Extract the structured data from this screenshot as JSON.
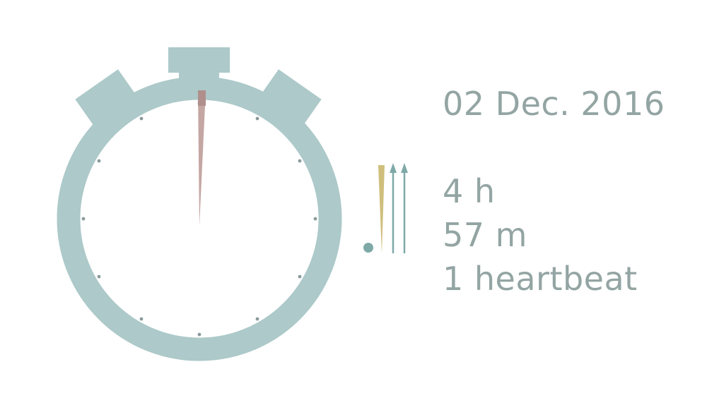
{
  "date": "02 Dec. 2016",
  "duration": {
    "hours": "4 h",
    "minutes": "57 m",
    "heartbeats": "1 heartbeat"
  },
  "colors": {
    "watch_body": "#adc9c9",
    "watch_body_dark": "#8fb6b6",
    "tick": "#8a9a9c",
    "second_hand": "#c4a6a3",
    "second_hand_tip": "#b08f8c",
    "hour_hand": "#cfbf7c",
    "minute_hand": "#7fa9a8",
    "text": "#93a5a3"
  },
  "icons": {
    "stopwatch": "stopwatch-icon",
    "legend": "clock-hands-legend-icon"
  },
  "second_hand_angle_deg": 1
}
